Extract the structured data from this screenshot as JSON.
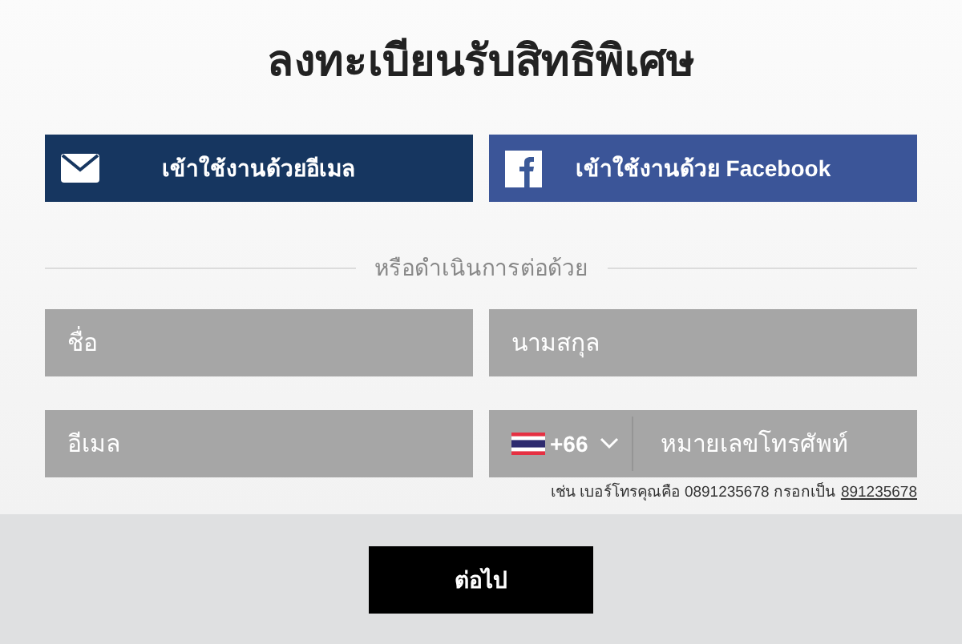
{
  "title": "ลงทะเบียนรับสิทธิพิเศษ",
  "login_buttons": [
    {
      "kind": "email",
      "label": "เข้าใช้งานด้วยอีเมล"
    },
    {
      "kind": "facebook",
      "label": "เข้าใช้งานด้วย Facebook"
    }
  ],
  "divider_text": "หรือดำเนินการต่อด้วย",
  "fields": [
    {
      "kind": "text",
      "placeholder": "ชื่อ"
    },
    {
      "kind": "text",
      "placeholder": "นามสกุล"
    },
    {
      "kind": "text",
      "placeholder": "อีเมล"
    },
    {
      "kind": "phone",
      "country_code": "+66",
      "placeholder": "หมายเลขโทรศัพท์"
    }
  ],
  "phone_hint": {
    "text": "เช่น เบอร์โทรคุณคือ 0891235678 กรอกเป็น",
    "example": "891235678"
  },
  "next_button": "ต่อไป"
}
